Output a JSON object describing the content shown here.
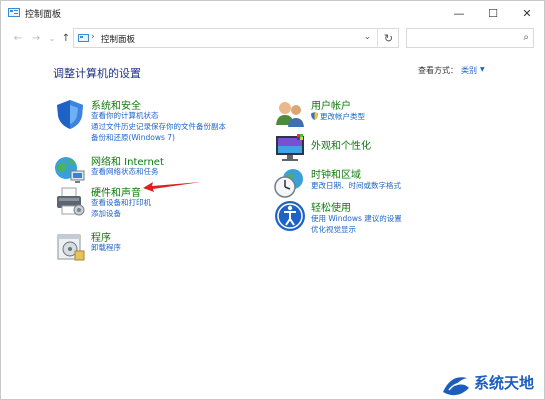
{
  "window": {
    "title": "控制面板",
    "controls": {
      "minimize": "—",
      "maximize": "☐",
      "close": "✕"
    }
  },
  "nav": {
    "back": "←",
    "forward": "→",
    "recent": "⌄",
    "up": "↑",
    "breadcrumb_separator": "›",
    "address": "控制面板",
    "address_dropdown": "⌄",
    "refresh": "↻",
    "search_placeholder": "",
    "search_icon": "⌕"
  },
  "content": {
    "heading": "调整计算机的设置",
    "view_by_label": "查看方式：",
    "view_by_value": "类别",
    "view_by_arrow": "▼"
  },
  "left_categories": [
    {
      "title": "系统和安全",
      "icon": "shield-icon",
      "links": [
        "查看你的计算机状态",
        "通过文件历史记录保存你的文件备份副本",
        "备份和还原(Windows 7)"
      ]
    },
    {
      "title": "网络和 Internet",
      "icon": "network-globe-icon",
      "links": [
        "查看网络状态和任务"
      ]
    },
    {
      "title": "硬件和声音",
      "icon": "printer-icon",
      "links": [
        "查看设备和打印机",
        "添加设备"
      ]
    },
    {
      "title": "程序",
      "icon": "programs-icon",
      "links": [
        "卸载程序"
      ]
    }
  ],
  "right_categories": [
    {
      "title": "用户帐户",
      "icon": "users-icon",
      "links": [
        "更改帐户类型"
      ]
    },
    {
      "title": "外观和个性化",
      "icon": "display-icon",
      "links": []
    },
    {
      "title": "时钟和区域",
      "icon": "clock-globe-icon",
      "links": [
        "更改日期、时间或数字格式"
      ]
    },
    {
      "title": "轻松使用",
      "icon": "accessibility-icon",
      "links": [
        "使用 Windows 建议的设置",
        "优化视觉显示"
      ]
    }
  ],
  "watermark": {
    "text": "系统天地"
  },
  "colors": {
    "category_title": "#0e7a0d",
    "link": "#1e64c8",
    "heading": "#1e3287",
    "annotation_arrow": "#e02020"
  }
}
